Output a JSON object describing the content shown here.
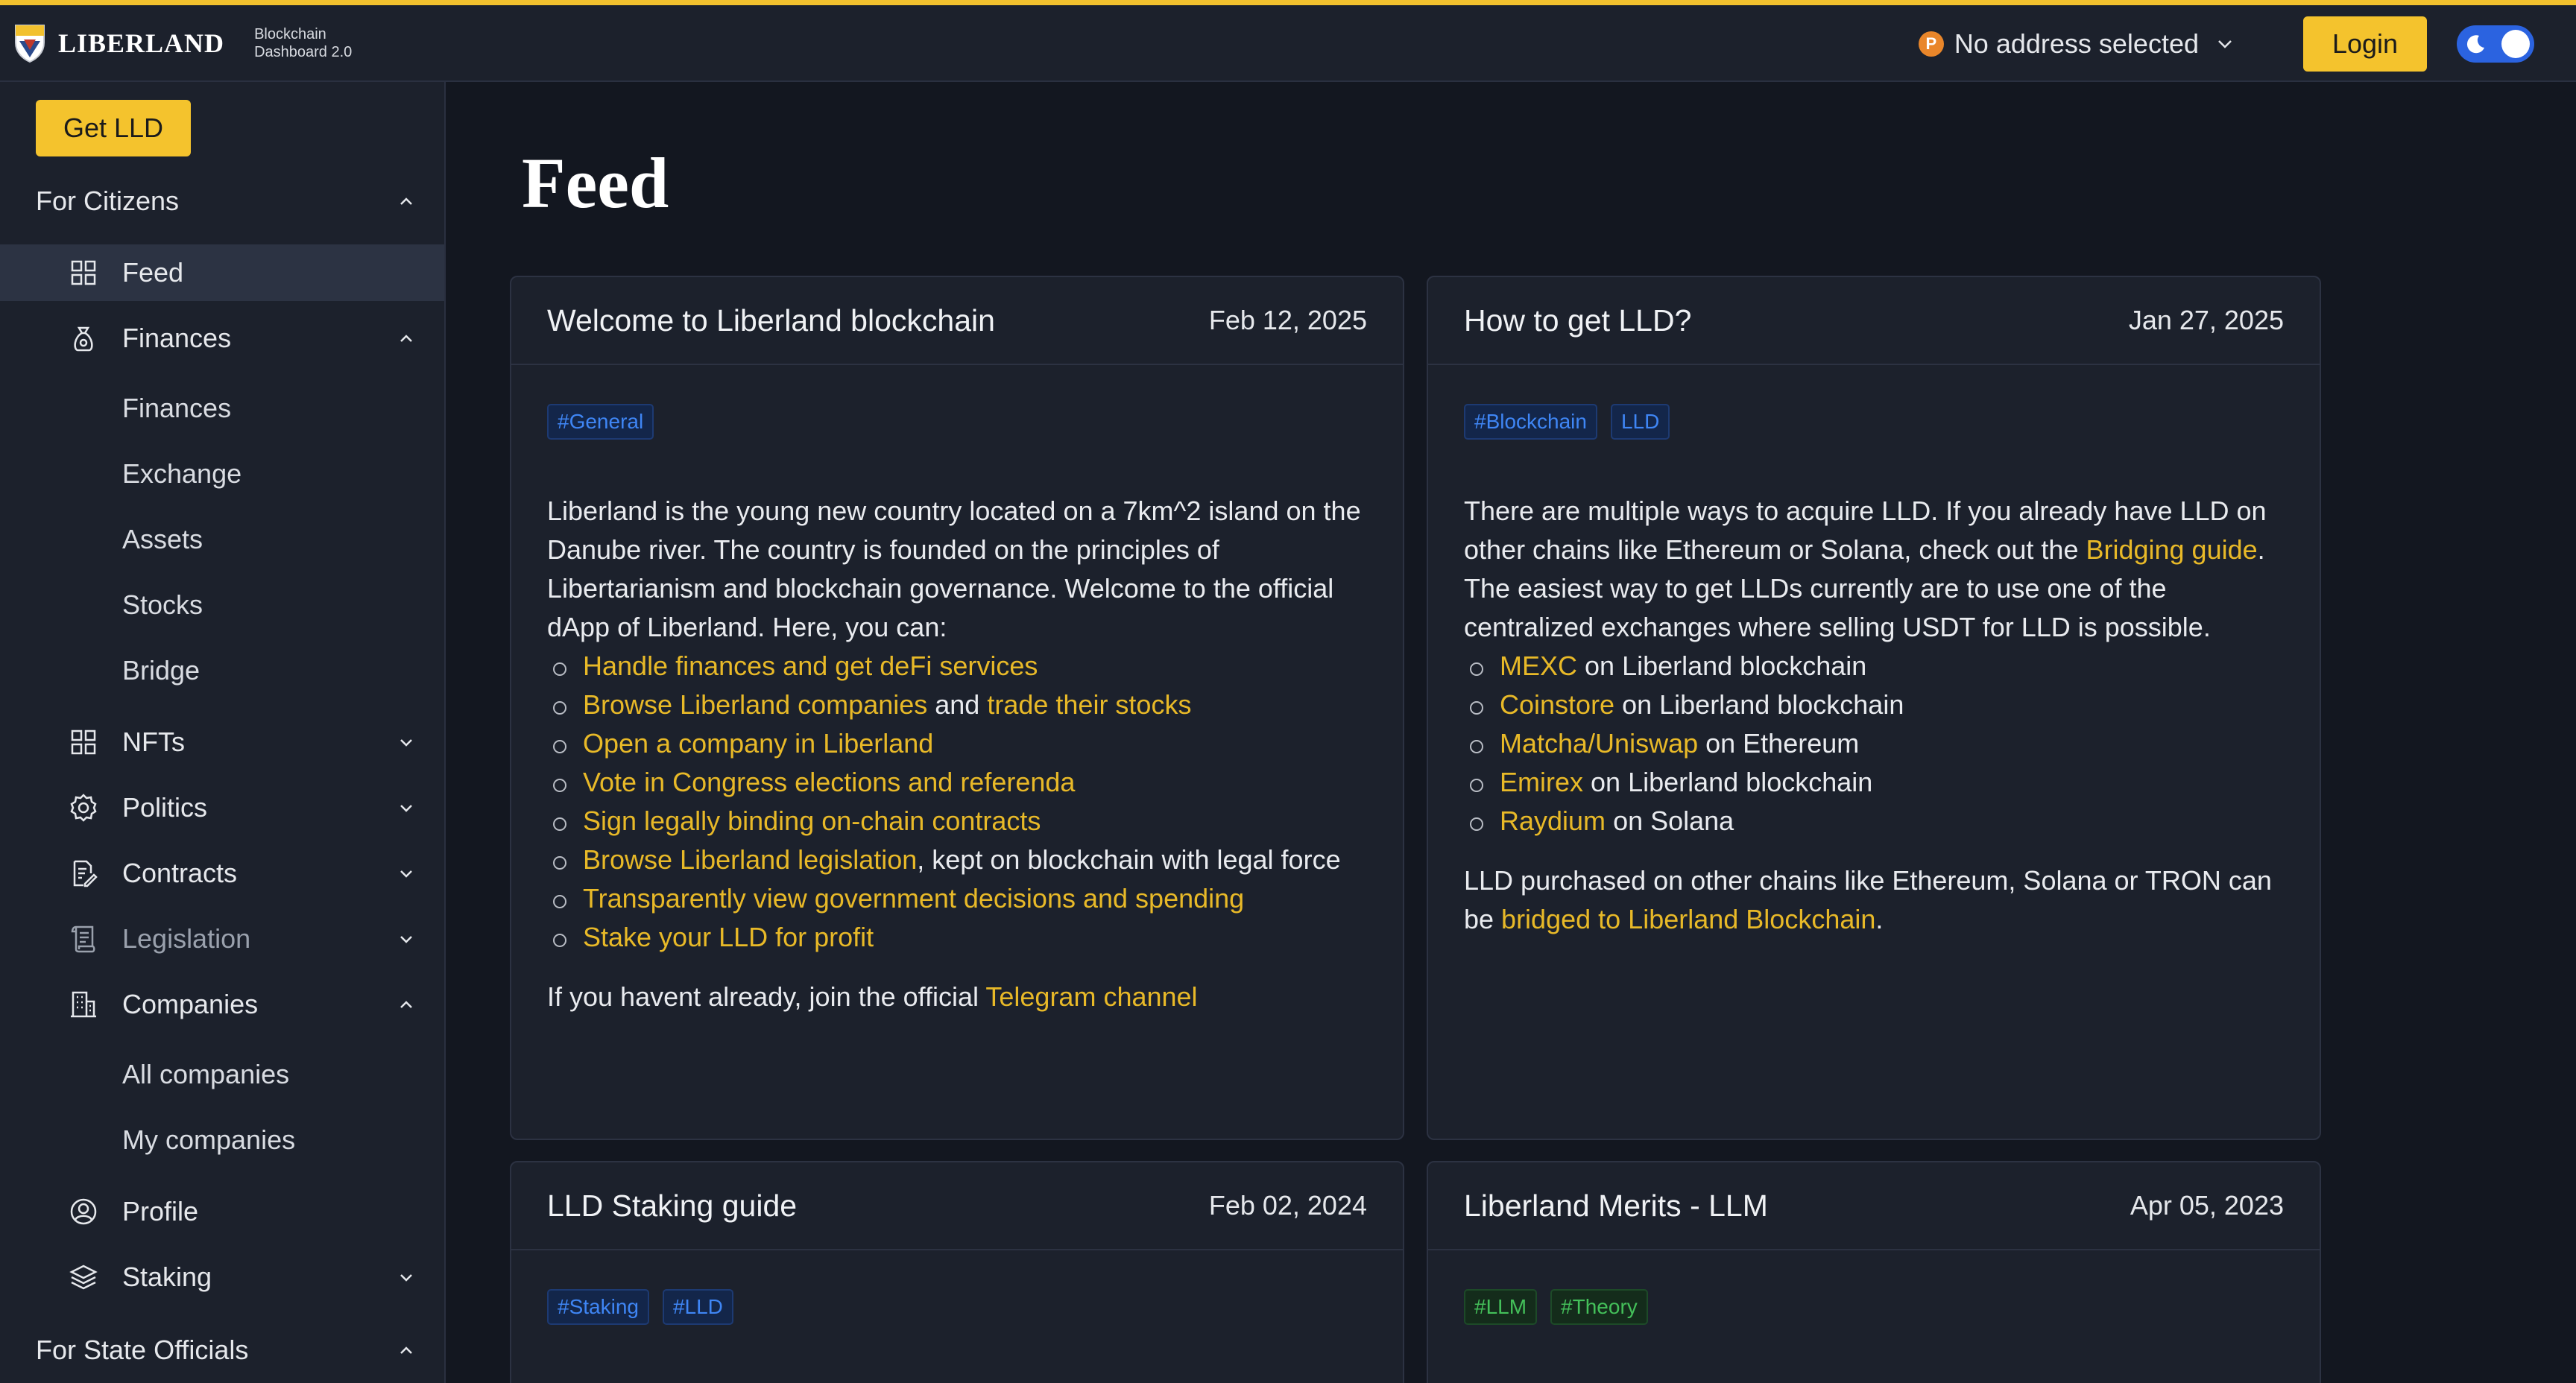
{
  "header": {
    "brand_name": "LIBERLAND",
    "brand_sub_line1": "Blockchain",
    "brand_sub_line2": "Dashboard 2.0",
    "address_label": "No address selected",
    "coin_glyph": "P",
    "login_label": "Login",
    "accent_color": "#f4c32d"
  },
  "sidebar": {
    "get_lld_label": "Get LLD",
    "citizens_title": "For Citizens",
    "feed": "Feed",
    "finances": "Finances",
    "finances_sub": [
      "Finances",
      "Exchange",
      "Assets",
      "Stocks",
      "Bridge"
    ],
    "nfts": "NFTs",
    "politics": "Politics",
    "contracts": "Contracts",
    "legislation": "Legislation",
    "companies": "Companies",
    "companies_sub": [
      "All companies",
      "My companies"
    ],
    "profile": "Profile",
    "staking": "Staking",
    "officials_title": "For State Officials"
  },
  "main": {
    "title": "Feed",
    "cards": [
      {
        "title": "Welcome to Liberland blockchain",
        "date": "Feb 12, 2025",
        "tags": [
          "#General"
        ],
        "intro": "Liberland is the young new country located on a 7km^2 island on the Danube river. The country is founded on the principles of Libertarianism and blockchain governance. Welcome to the official dApp of Liberland. Here, you can:",
        "items": {
          "i0": "Handle finances and get deFi services",
          "i1a": "Browse Liberland companies",
          "i1b": " and ",
          "i1c": "trade their stocks",
          "i2": "Open a company in Liberland",
          "i3": "Vote in Congress elections and referenda",
          "i4": "Sign legally binding on-chain contracts",
          "i5a": "Browse Liberland legislation",
          "i5b": ", kept on blockchain with legal force",
          "i6": "Transparently view government decisions and spending",
          "i7": "Stake your LLD for profit"
        },
        "outro_text": "If you havent already, join the official ",
        "outro_link": "Telegram channel"
      },
      {
        "title": "How to get LLD?",
        "date": "Jan 27, 2025",
        "tags": [
          "#Blockchain",
          "LLD"
        ],
        "intro_a": "There are multiple ways to acquire LLD. If you already have LLD on other chains like Ethereum or Solana, check out the ",
        "intro_link": "Bridging guide",
        "intro_b": ". The easiest way to get LLDs currently are to use one of the centralized exchanges where selling USDT for LLD is possible.",
        "exchanges": [
          {
            "name": "MEXC",
            "chain": " on Liberland blockchain"
          },
          {
            "name": "Coinstore",
            "chain": " on Liberland blockchain"
          },
          {
            "name": "Matcha/Uniswap",
            "chain": " on Ethereum"
          },
          {
            "name": "Emirex",
            "chain": " on Liberland blockchain"
          },
          {
            "name": "Raydium",
            "chain": " on Solana"
          }
        ],
        "outro_a": "LLD purchased on other chains like Ethereum, Solana or TRON can be ",
        "outro_link": "bridged to Liberland Blockchain",
        "outro_b": "."
      },
      {
        "title": "LLD Staking guide",
        "date": "Feb 02, 2024",
        "tags": [
          "#Staking",
          "#LLD"
        ]
      },
      {
        "title": "Liberland Merits - LLM",
        "date": "Apr 05, 2023",
        "tags": [
          "#LLM",
          "#Theory"
        ]
      }
    ]
  }
}
